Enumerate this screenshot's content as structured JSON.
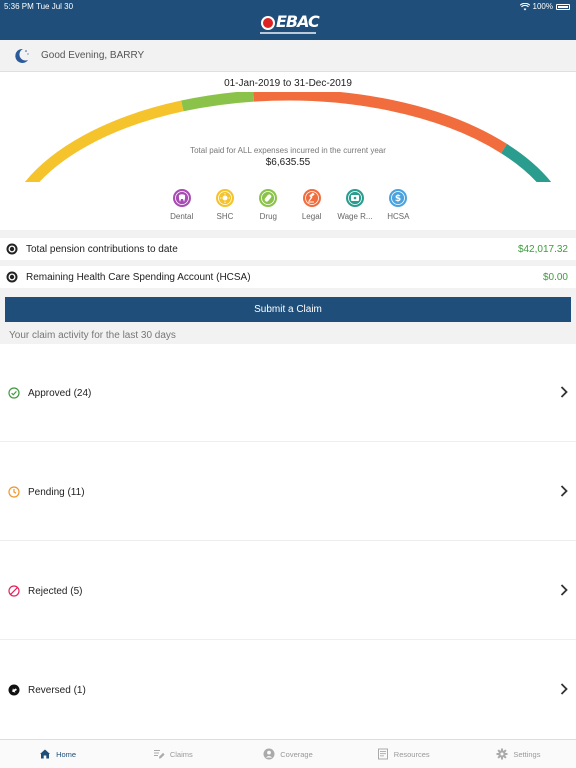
{
  "status_bar": {
    "time": "5:36 PM",
    "date": "Tue Jul 30",
    "battery": "100%"
  },
  "header": {
    "logo_text": "EBAC"
  },
  "greeting": {
    "text": "Good Evening, BARRY"
  },
  "summary": {
    "date_range": "01-Jan-2019 to 31-Dec-2019",
    "total_label": "Total paid for ALL expenses incurred in the current year",
    "total_value": "$6,635.55",
    "gauge_colors": [
      "#a94bb5",
      "#f5c32c",
      "#8bc34a",
      "#f26d3d",
      "#2a9d8f",
      "#4aa3df"
    ]
  },
  "categories": [
    {
      "label": "Dental",
      "icon": "tooth-icon",
      "color": "#a94bb5"
    },
    {
      "label": "SHC",
      "icon": "sun-icon",
      "color": "#f5c32c"
    },
    {
      "label": "Drug",
      "icon": "pill-icon",
      "color": "#8bc34a"
    },
    {
      "label": "Legal",
      "icon": "gavel-icon",
      "color": "#f26d3d"
    },
    {
      "label": "Wage R...",
      "icon": "wallet-icon",
      "color": "#2a9d8f"
    },
    {
      "label": "HCSA",
      "icon": "dollar-icon",
      "color": "#4aa3df"
    }
  ],
  "info_rows": [
    {
      "label": "Total pension contributions to date",
      "value": "$42,017.32"
    },
    {
      "label": "Remaining Health Care Spending Account (HCSA)",
      "value": "$0.00"
    }
  ],
  "submit_label": "Submit a Claim",
  "activity_title": "Your claim activity for the last 30 days",
  "claims": [
    {
      "label": "Approved (24)",
      "icon": "check-circle-icon",
      "color": "#3e9b3e"
    },
    {
      "label": "Pending (11)",
      "icon": "clock-icon",
      "color": "#f0952b"
    },
    {
      "label": "Rejected (5)",
      "icon": "block-icon",
      "color": "#e0245e"
    },
    {
      "label": "Reversed (1)",
      "icon": "reverse-icon",
      "color": "#111111"
    }
  ],
  "tabs": [
    {
      "label": "Home",
      "icon": "home-icon",
      "active": true
    },
    {
      "label": "Claims",
      "icon": "edit-icon",
      "active": false
    },
    {
      "label": "Coverage",
      "icon": "person-icon",
      "active": false
    },
    {
      "label": "Resources",
      "icon": "document-icon",
      "active": false
    },
    {
      "label": "Settings",
      "icon": "gear-icon",
      "active": false
    }
  ],
  "colors": {
    "primary": "#1e4e79",
    "positive": "#3e9b3e"
  }
}
